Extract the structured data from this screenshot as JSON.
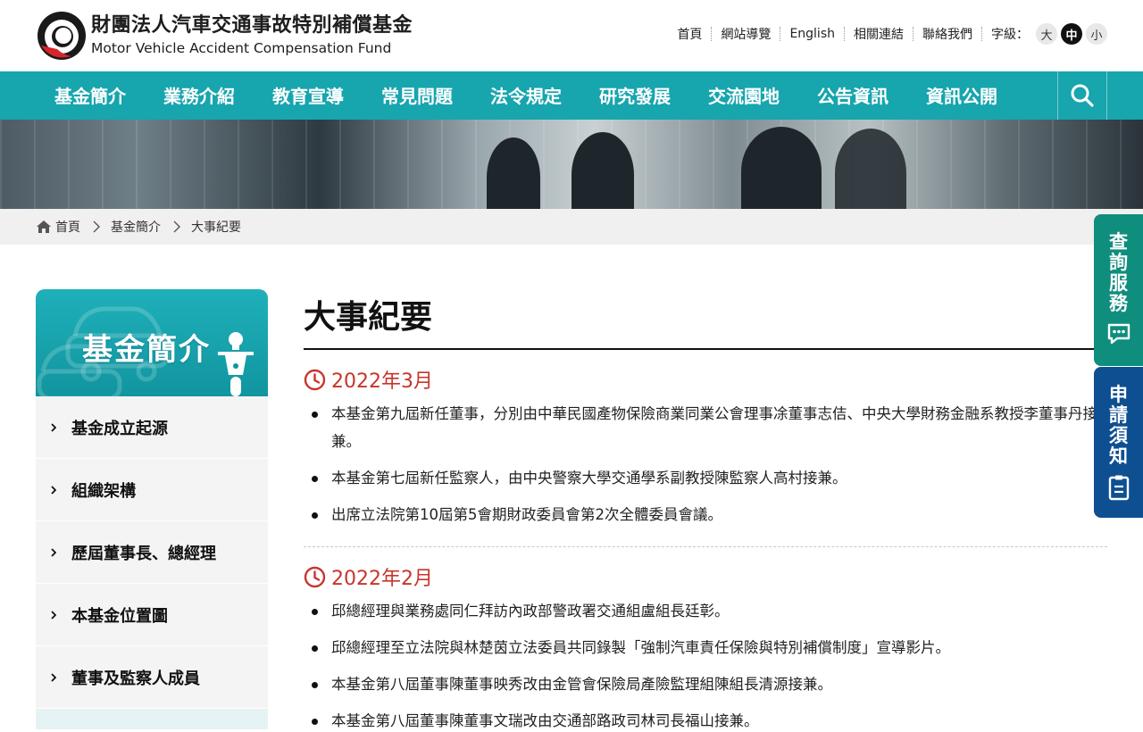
{
  "site": {
    "name_zh": "財團法人汽車交通事故特別補償基金",
    "name_en": "Motor Vehicle Accident Compensation Fund"
  },
  "toplinks": {
    "items": [
      "首頁",
      "網站導覽",
      "English",
      "相關連結",
      "聯絡我們"
    ],
    "font_size_label": "字級：",
    "font_sizes": [
      "大",
      "中",
      "小"
    ],
    "font_size_selected": "中"
  },
  "nav": {
    "items": [
      "基金簡介",
      "業務介紹",
      "教育宣導",
      "常見問題",
      "法令規定",
      "研究發展",
      "交流園地",
      "公告資訊",
      "資訊公開"
    ],
    "search_icon": "search-icon"
  },
  "breadcrumb": [
    "首頁",
    "基金簡介",
    "大事紀要"
  ],
  "sidebar": {
    "title": "基金簡介",
    "items": [
      "基金成立起源",
      "組織架構",
      "歷屆董事長、總經理",
      "本基金位置圖",
      "董事及監察人成員"
    ]
  },
  "main": {
    "title": "大事紀要",
    "sections": [
      {
        "date": "2022年3月",
        "items": [
          "本基金第九屆新任董事，分別由中華民國產物保險商業同業公會理事凃董事志佶、中央大學財務金融系教授李董事丹接兼。",
          "本基金第七屆新任監察人，由中央警察大學交通學系副教授陳監察人高村接兼。",
          "出席立法院第10屆第5會期財政委員會第2次全體委員會議。"
        ]
      },
      {
        "date": "2022年2月",
        "items": [
          "邱總經理與業務處同仁拜訪內政部警政署交通組盧組長廷彰。",
          "邱總經理至立法院與林楚茵立法委員共同錄製「強制汽車責任保險與特別補償制度」宣導影片。",
          "本基金第八屆董事陳董事映秀改由金管會保險局產險監理組陳組長清源接兼。",
          "本基金第八屆董事陳董事文瑞改由交通部路政司林司長福山接兼。"
        ]
      }
    ]
  },
  "float_tabs": [
    {
      "label": "查詢服務",
      "icon": "chat-icon",
      "color": "#0f8e7e"
    },
    {
      "label": "申請須知",
      "icon": "clipboard-icon",
      "color": "#0e4f92"
    }
  ],
  "colors": {
    "nav_bg": "#17a5ae",
    "date_accent": "#c8352c",
    "sidebar_item_bg": "#f4f4f4"
  }
}
